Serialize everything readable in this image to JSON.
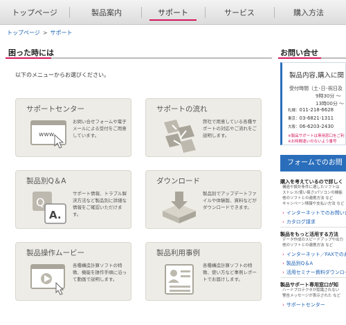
{
  "nav": {
    "items": [
      {
        "label": "トップページ"
      },
      {
        "label": "製品案内"
      },
      {
        "label": "サポート"
      },
      {
        "label": "サービス"
      },
      {
        "label": "購入方法"
      }
    ]
  },
  "breadcrumb": {
    "home": "トップページ",
    "separator": ">",
    "current": "サポート"
  },
  "main": {
    "heading": "困った時には",
    "intro": "以下のメニューからお選びください。",
    "cards": [
      {
        "title": "サポートセンター",
        "body": "お問い合せフォームや電子メールによる受付をご用意しています。",
        "icon_text": "www"
      },
      {
        "title": "サポートの流れ",
        "body": "弊社で用意している各種サポートの対応やご流れをご説明します。"
      },
      {
        "title": "製品別Q＆A",
        "body": "サポート情報、トラブル解決方法など製品別に詳細な情報をご確認いただけます。",
        "icon_q": "Q.",
        "icon_a": "A."
      },
      {
        "title": "ダウンロード",
        "body": "製品別でアップデートファイルや体験版、資料などがダウンロードできます。"
      },
      {
        "title": "製品操作ムービー",
        "body": "各種構造計算ソフトの特徴、機能を操作手順に沿って動画で説明します。"
      },
      {
        "title": "製品利用事例",
        "body": "各種構造計算ソフトの特徴、使い方など事例レポートでお届けします。"
      }
    ]
  },
  "side": {
    "heading": "お問い合せ",
    "contact": {
      "title": "製品内容,購入に関",
      "hours_1": "受付時間（土･日･祝日及",
      "hours_2": "9時30分 〜",
      "hours_3": "13時00分 〜",
      "phones": [
        {
          "label": "札幌：",
          "number": "011-218-6628"
        },
        {
          "label": "東京：",
          "number": "03-6821-1311"
        },
        {
          "label": "大阪：",
          "number": "06-6203-2430"
        }
      ],
      "note_1": "※製品サポートは専用窓口をご利",
      "note_2": "※お時間違いのないよう番号"
    },
    "form_button": "フォームでのお問",
    "block1": {
      "heading": "購入を考えているので詳しく",
      "text_1": "構造や設計条件に適したソフトは",
      "text_2": "ストレス(使い易さ)パソコンの機能",
      "text_3": "他のソフトとの連携方法 など",
      "text_4": "キャンペーン情報や支払い方法 など",
      "links": [
        "インターネットでのお問い合せ",
        "カタログ請求"
      ]
    },
    "block2": {
      "heading": "製品をもっと活用する方法",
      "text_1": "データ作成のスピードアップや出力",
      "text_2": "他のソフトとの連携方法 など",
      "links": [
        "インターネット／FAXでのお問",
        "製品別Q＆A",
        "活用セミナー資料ダウンロード"
      ]
    },
    "block3": {
      "heading": "製品サポート専用窓口が知",
      "text_1": "ハードプロテクタが認識されない",
      "text_2": "警告メッセージが表示された など",
      "links": [
        "サポートセンター"
      ]
    }
  }
}
